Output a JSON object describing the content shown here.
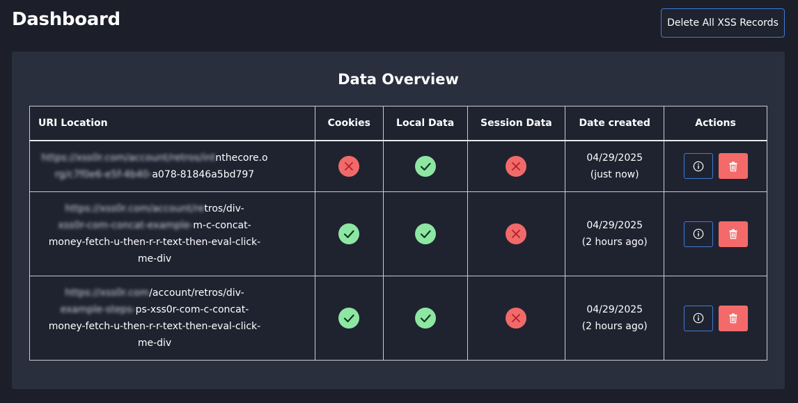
{
  "header": {
    "title": "Dashboard",
    "delete_all_label": "Delete All XSS Records"
  },
  "panel": {
    "title": "Data Overview"
  },
  "table": {
    "columns": [
      "URI Location",
      "Cookies",
      "Local Data",
      "Session Data",
      "Date created",
      "Actions"
    ],
    "rows": [
      {
        "uri_hidden_1": "https://xss0r.com/account/retros/inthecore.o",
        "uri_hidden_2": "rg/c7f0e6-e5f-4b40-",
        "uri_visible_1": "nthecore.o",
        "uri_visible_2": "a078-81846a5bd797",
        "cookies": false,
        "local_data": true,
        "session_data": false,
        "date": "04/29/2025",
        "relative": "(just now)"
      },
      {
        "uri_hidden_1": "https://xss0r.com/account/re",
        "uri_hidden_2": "xss0r-com-concat-example-",
        "uri_visible_1": "tros/div-",
        "uri_visible_2": "m-c-concat-",
        "uri_visible_3": "money-fetch-u-then-r-r-text-then-eval-click-",
        "uri_visible_4": "me-div",
        "cookies": true,
        "local_data": true,
        "session_data": false,
        "date": "04/29/2025",
        "relative": "(2 hours ago)"
      },
      {
        "uri_hidden_1": "https://xss0r.com",
        "uri_hidden_2": "example-steps-",
        "uri_visible_1": "/account/retros/div-",
        "uri_visible_2": "ps-xss0r-com-c-concat-",
        "uri_visible_3": "money-fetch-u-then-r-r-text-then-eval-click-",
        "uri_visible_4": "me-div",
        "cookies": true,
        "local_data": true,
        "session_data": false,
        "date": "04/29/2025",
        "relative": "(2 hours ago)"
      }
    ]
  },
  "colors": {
    "background": "#1c1f2a",
    "panel": "#2a2f3d",
    "accent_blue": "#3f7bd8",
    "success": "#8ee6a3",
    "danger": "#f16a6a"
  },
  "icons": {
    "yes": "check-circle-icon",
    "no": "x-circle-icon",
    "info": "info-icon",
    "delete": "trash-icon"
  }
}
